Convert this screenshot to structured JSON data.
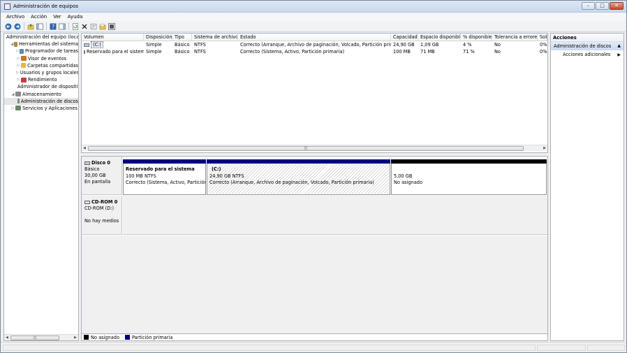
{
  "window": {
    "title": "Administración de equipos",
    "btn_minimize": "–",
    "btn_maximize": "□",
    "btn_close": "✕"
  },
  "menu": [
    "Archivo",
    "Acción",
    "Ver",
    "Ayuda"
  ],
  "toolbar_icons": [
    "back-arrow-icon",
    "forward-arrow-icon",
    "up-folder-icon",
    "show-hide-tree-icon",
    "help-icon",
    "show-hide-action-icon",
    "refresh-icon",
    "delete-icon",
    "properties-icon",
    "open-icon",
    "export-icon"
  ],
  "tree": [
    {
      "label": "Administración del equipo (local)",
      "expander": "",
      "icon": "computer-icon",
      "indent": 0
    },
    {
      "label": "Herramientas del sistema",
      "expander": "◢",
      "icon": "tools-icon",
      "indent": 1
    },
    {
      "label": "Programador de tareas",
      "expander": "▷",
      "icon": "scheduler-icon",
      "indent": 2
    },
    {
      "label": "Visor de eventos",
      "expander": "▷",
      "icon": "event-viewer-icon",
      "indent": 2
    },
    {
      "label": "Carpetas compartidas",
      "expander": "▷",
      "icon": "shared-folder-icon",
      "indent": 2
    },
    {
      "label": "Usuarios y grupos locales",
      "expander": "▷",
      "icon": "users-icon",
      "indent": 2
    },
    {
      "label": "Rendimiento",
      "expander": "▷",
      "icon": "performance-icon",
      "indent": 2
    },
    {
      "label": "Administrador de dispositivos",
      "expander": "",
      "icon": "device-manager-icon",
      "indent": 2
    },
    {
      "label": "Almacenamiento",
      "expander": "◢",
      "icon": "storage-icon",
      "indent": 1
    },
    {
      "label": "Administración de discos",
      "expander": "",
      "icon": "disk-management-icon",
      "indent": 2,
      "selected": true
    },
    {
      "label": "Servicios y Aplicaciones",
      "expander": "▷",
      "icon": "services-icon",
      "indent": 1
    }
  ],
  "volumes": {
    "columns": [
      "Volumen",
      "Disposición",
      "Tipo",
      "Sistema de archivos",
      "Estado",
      "Capacidad",
      "Espacio disponible",
      "% disponible",
      "Tolerancia a errores",
      "Sob"
    ],
    "rows": [
      [
        "(C:)",
        "Simple",
        "Básico",
        "NTFS",
        "Correcto (Arranque, Archivo de paginación, Volcado, Partición primaria)",
        "24,90 GB",
        "1,09 GB",
        "4 %",
        "No",
        "0%"
      ],
      [
        "Reservado para el sistema",
        "Simple",
        "Básico",
        "NTFS",
        "Correcto (Sistema, Activo, Partición primaria)",
        "100 MB",
        "71 MB",
        "71 %",
        "No",
        "0%"
      ]
    ]
  },
  "disks": [
    {
      "name": "Disco 0",
      "lines": [
        "Básico",
        "30,00 GB",
        "En pantalla"
      ],
      "partitions": [
        {
          "title": "Reservado para el sistema",
          "size": "100 MB NTFS",
          "status": "Correcto (Sistema, Activo, Partición primaria)"
        },
        {
          "title": "(C:)",
          "size": "24,90 GB NTFS",
          "status": "Correcto (Arranque, Archivo de paginación, Volcado, Partición primaria)"
        },
        {
          "title": "",
          "size": "5,00 GB",
          "status": "No asignado"
        }
      ]
    },
    {
      "name": "CD-ROM 0",
      "lines": [
        "CD-ROM (D:)",
        "",
        "No hay medios"
      ]
    }
  ],
  "legend": [
    {
      "label": "No asignado",
      "color": "#000000"
    },
    {
      "label": "Partición primaria",
      "color": "#00007f"
    }
  ],
  "actions": {
    "header": "Acciones",
    "section": "Administración de discos",
    "item": "Acciones adicionales"
  },
  "colors": {
    "primary_partition": "#00007f",
    "unallocated": "#000000"
  }
}
